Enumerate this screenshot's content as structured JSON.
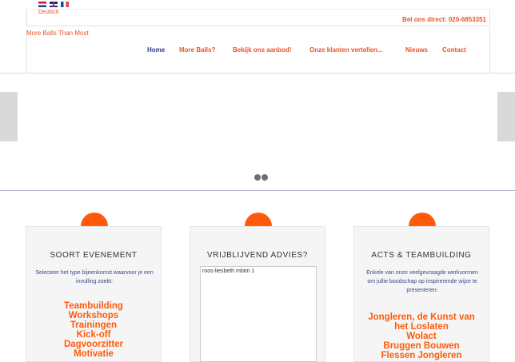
{
  "languages": [
    {
      "name": "nl-flag-icon"
    },
    {
      "name": "uk-flag-icon"
    },
    {
      "name": "fr-flag-icon"
    }
  ],
  "language_link": "Deutsch",
  "phone": "Bel ons direct: 020-6853351",
  "logo": "More Balls Than Most",
  "nav": {
    "home": "Home",
    "more_balls": "More Balls?",
    "aanbod": "Bekijk ons aanbod!",
    "klanten": "Onze klanten vertellen...",
    "nieuws": "Nieuws",
    "contact": "Contact"
  },
  "colors": {
    "accent": "#ff5a09",
    "nav_active": "#2b3a8c"
  },
  "boxes": {
    "evenement": {
      "title": "SOORT EVENEMENT",
      "desc": "Selecteer het type bijeenkomst waarvoor je een invulling zoekt:",
      "items": [
        "Teambuilding",
        "Workshops",
        "Trainingen",
        "Kick-off",
        "Dagvoorzitter",
        "Motivatie"
      ]
    },
    "advies": {
      "title": "VRIJBLIJVEND ADVIES?",
      "chat_text": "roos-liesbeth mbtm 1"
    },
    "acts": {
      "title": "ACTS & TEAMBUILDING",
      "desc": "Enkele van onze veelgevraagde werkvormen om jullie boodschap op inspirerende wijze te presenteren:",
      "items": [
        "Jongleren, de Kunst van",
        "het Loslaten",
        "Wolact",
        "Bruggen Bouwen",
        "Flessen Jongleren"
      ]
    }
  }
}
